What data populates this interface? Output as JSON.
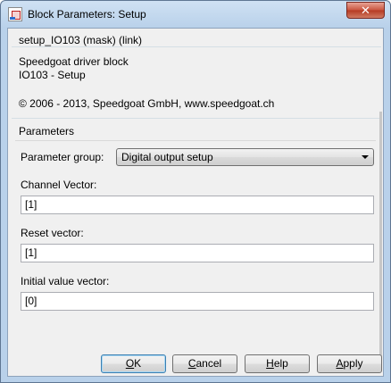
{
  "window": {
    "title": "Block Parameters: Setup",
    "close_glyph": "✕"
  },
  "mask": {
    "title": "setup_IO103 (mask) (link)",
    "description_lines": [
      "Speedgoat driver block",
      "IO103 - Setup",
      "",
      "© 2006 - 2013, Speedgoat GmbH, www.speedgoat.ch"
    ]
  },
  "parameters": {
    "heading": "Parameters",
    "group_label": "Parameter group:",
    "group_value": "Digital output setup",
    "fields": [
      {
        "label": "Channel Vector:",
        "value": "[1]"
      },
      {
        "label": "Reset vector:",
        "value": "[1]"
      },
      {
        "label": "Initial value vector:",
        "value": "[0]"
      }
    ]
  },
  "buttons": {
    "ok": {
      "mnemonic": "O",
      "rest": "K"
    },
    "cancel": {
      "mnemonic": "C",
      "rest": "ancel"
    },
    "help": {
      "mnemonic": "H",
      "rest": "elp"
    },
    "apply": {
      "mnemonic": "A",
      "rest": "pply"
    }
  }
}
